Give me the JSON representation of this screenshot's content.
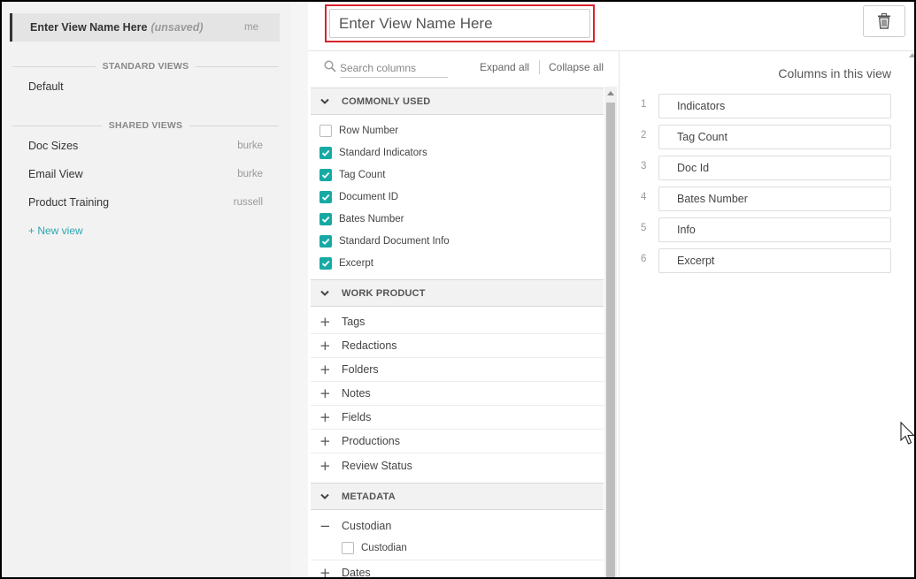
{
  "sidebar": {
    "active_view": {
      "name": "Enter View Name Here",
      "status": "(unsaved)",
      "owner": "me"
    },
    "standard_heading": "STANDARD VIEWS",
    "standard_views": [
      {
        "name": "Default"
      }
    ],
    "shared_heading": "SHARED VIEWS",
    "shared_views": [
      {
        "name": "Doc Sizes",
        "owner": "burke"
      },
      {
        "name": "Email View",
        "owner": "burke"
      },
      {
        "name": "Product Training",
        "owner": "russell"
      }
    ],
    "new_view_label": "+ New view"
  },
  "editor": {
    "name_placeholder": "Enter View Name Here",
    "name_value": "",
    "delete_icon": "trash-icon",
    "highlight_color": "#d9232e"
  },
  "columns": {
    "search_placeholder": "Search columns",
    "expand_all": "Expand all",
    "collapse_all": "Collapse all",
    "accent_color": "#17a9a4",
    "groups": [
      {
        "title": "COMMONLY USED",
        "expanded": true,
        "items": [
          {
            "label": "Row Number",
            "checked": false
          },
          {
            "label": "Standard Indicators",
            "checked": true
          },
          {
            "label": "Tag Count",
            "checked": true
          },
          {
            "label": "Document ID",
            "checked": true
          },
          {
            "label": "Bates Number",
            "checked": true
          },
          {
            "label": "Standard Document Info",
            "checked": true
          },
          {
            "label": "Excerpt",
            "checked": true
          }
        ]
      },
      {
        "title": "WORK PRODUCT",
        "expanded": true,
        "subgroups": [
          {
            "label": "Tags",
            "expanded": false
          },
          {
            "label": "Redactions",
            "expanded": false
          },
          {
            "label": "Folders",
            "expanded": false
          },
          {
            "label": "Notes",
            "expanded": false
          },
          {
            "label": "Fields",
            "expanded": false
          },
          {
            "label": "Productions",
            "expanded": false
          },
          {
            "label": "Review Status",
            "expanded": false
          }
        ]
      },
      {
        "title": "METADATA",
        "expanded": true,
        "subgroups": [
          {
            "label": "Custodian",
            "expanded": true,
            "items": [
              {
                "label": "Custodian",
                "checked": false
              }
            ]
          },
          {
            "label": "Dates",
            "expanded": false
          }
        ]
      }
    ]
  },
  "selected": {
    "title": "Columns in this view",
    "items": [
      {
        "num": "1",
        "label": "Indicators"
      },
      {
        "num": "2",
        "label": "Tag Count"
      },
      {
        "num": "3",
        "label": "Doc Id"
      },
      {
        "num": "4",
        "label": "Bates Number"
      },
      {
        "num": "5",
        "label": "Info"
      },
      {
        "num": "6",
        "label": "Excerpt"
      }
    ]
  }
}
